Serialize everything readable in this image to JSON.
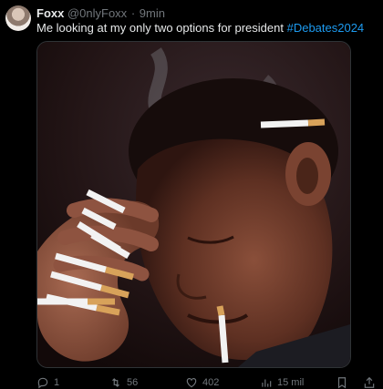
{
  "tweet": {
    "author_name": "Foxx",
    "handle": "@0nlyFoxx",
    "separator": "·",
    "time": "9min",
    "text": "Me looking at my only two options for president ",
    "hashtag": "#Debates2024"
  },
  "actions": {
    "replies": "1",
    "retweets": "56",
    "likes": "402",
    "views": "15 mil"
  },
  "colors": {
    "background": "#000000",
    "text": "#e7e9ea",
    "muted": "#71767b",
    "accent": "#1d9bf0"
  },
  "icons": [
    "reply-icon",
    "retweet-icon",
    "like-icon",
    "views-icon",
    "bookmark-icon",
    "share-icon"
  ]
}
